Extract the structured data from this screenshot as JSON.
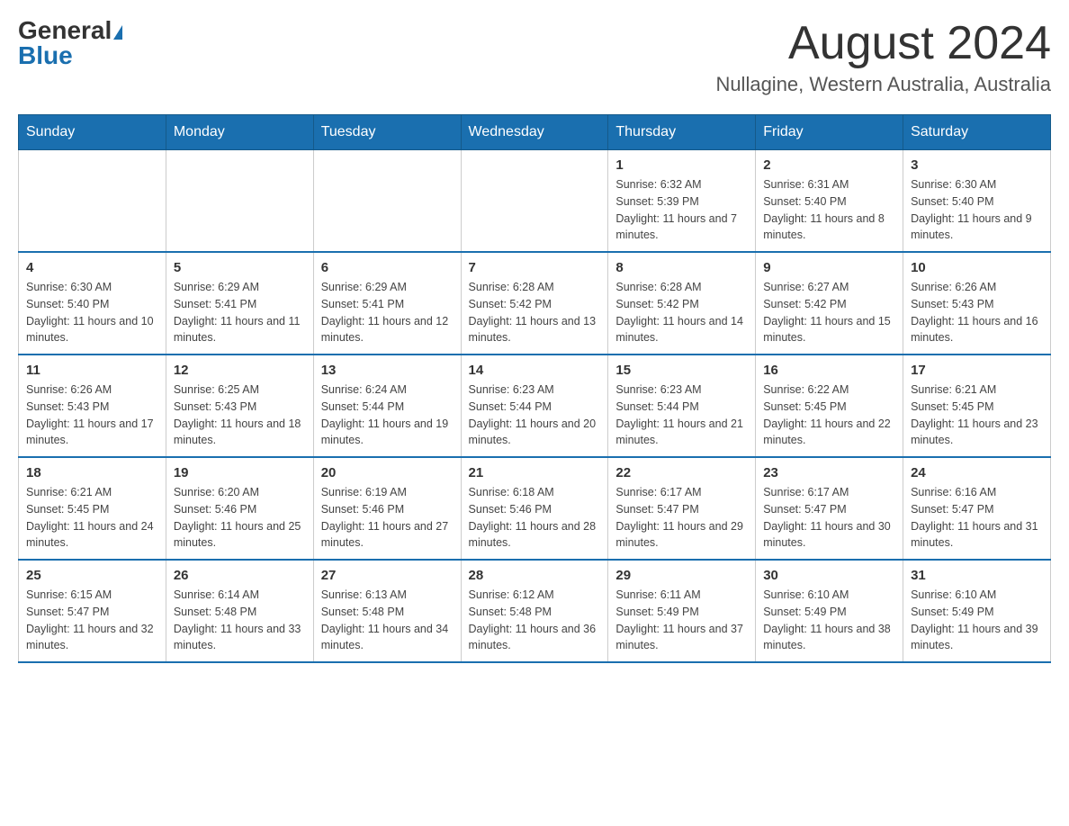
{
  "header": {
    "logo_general": "General",
    "logo_blue": "Blue",
    "month_title": "August 2024",
    "location": "Nullagine, Western Australia, Australia"
  },
  "days_of_week": [
    "Sunday",
    "Monday",
    "Tuesday",
    "Wednesday",
    "Thursday",
    "Friday",
    "Saturday"
  ],
  "weeks": [
    [
      {
        "day": "",
        "info": ""
      },
      {
        "day": "",
        "info": ""
      },
      {
        "day": "",
        "info": ""
      },
      {
        "day": "",
        "info": ""
      },
      {
        "day": "1",
        "info": "Sunrise: 6:32 AM\nSunset: 5:39 PM\nDaylight: 11 hours and 7 minutes."
      },
      {
        "day": "2",
        "info": "Sunrise: 6:31 AM\nSunset: 5:40 PM\nDaylight: 11 hours and 8 minutes."
      },
      {
        "day": "3",
        "info": "Sunrise: 6:30 AM\nSunset: 5:40 PM\nDaylight: 11 hours and 9 minutes."
      }
    ],
    [
      {
        "day": "4",
        "info": "Sunrise: 6:30 AM\nSunset: 5:40 PM\nDaylight: 11 hours and 10 minutes."
      },
      {
        "day": "5",
        "info": "Sunrise: 6:29 AM\nSunset: 5:41 PM\nDaylight: 11 hours and 11 minutes."
      },
      {
        "day": "6",
        "info": "Sunrise: 6:29 AM\nSunset: 5:41 PM\nDaylight: 11 hours and 12 minutes."
      },
      {
        "day": "7",
        "info": "Sunrise: 6:28 AM\nSunset: 5:42 PM\nDaylight: 11 hours and 13 minutes."
      },
      {
        "day": "8",
        "info": "Sunrise: 6:28 AM\nSunset: 5:42 PM\nDaylight: 11 hours and 14 minutes."
      },
      {
        "day": "9",
        "info": "Sunrise: 6:27 AM\nSunset: 5:42 PM\nDaylight: 11 hours and 15 minutes."
      },
      {
        "day": "10",
        "info": "Sunrise: 6:26 AM\nSunset: 5:43 PM\nDaylight: 11 hours and 16 minutes."
      }
    ],
    [
      {
        "day": "11",
        "info": "Sunrise: 6:26 AM\nSunset: 5:43 PM\nDaylight: 11 hours and 17 minutes."
      },
      {
        "day": "12",
        "info": "Sunrise: 6:25 AM\nSunset: 5:43 PM\nDaylight: 11 hours and 18 minutes."
      },
      {
        "day": "13",
        "info": "Sunrise: 6:24 AM\nSunset: 5:44 PM\nDaylight: 11 hours and 19 minutes."
      },
      {
        "day": "14",
        "info": "Sunrise: 6:23 AM\nSunset: 5:44 PM\nDaylight: 11 hours and 20 minutes."
      },
      {
        "day": "15",
        "info": "Sunrise: 6:23 AM\nSunset: 5:44 PM\nDaylight: 11 hours and 21 minutes."
      },
      {
        "day": "16",
        "info": "Sunrise: 6:22 AM\nSunset: 5:45 PM\nDaylight: 11 hours and 22 minutes."
      },
      {
        "day": "17",
        "info": "Sunrise: 6:21 AM\nSunset: 5:45 PM\nDaylight: 11 hours and 23 minutes."
      }
    ],
    [
      {
        "day": "18",
        "info": "Sunrise: 6:21 AM\nSunset: 5:45 PM\nDaylight: 11 hours and 24 minutes."
      },
      {
        "day": "19",
        "info": "Sunrise: 6:20 AM\nSunset: 5:46 PM\nDaylight: 11 hours and 25 minutes."
      },
      {
        "day": "20",
        "info": "Sunrise: 6:19 AM\nSunset: 5:46 PM\nDaylight: 11 hours and 27 minutes."
      },
      {
        "day": "21",
        "info": "Sunrise: 6:18 AM\nSunset: 5:46 PM\nDaylight: 11 hours and 28 minutes."
      },
      {
        "day": "22",
        "info": "Sunrise: 6:17 AM\nSunset: 5:47 PM\nDaylight: 11 hours and 29 minutes."
      },
      {
        "day": "23",
        "info": "Sunrise: 6:17 AM\nSunset: 5:47 PM\nDaylight: 11 hours and 30 minutes."
      },
      {
        "day": "24",
        "info": "Sunrise: 6:16 AM\nSunset: 5:47 PM\nDaylight: 11 hours and 31 minutes."
      }
    ],
    [
      {
        "day": "25",
        "info": "Sunrise: 6:15 AM\nSunset: 5:47 PM\nDaylight: 11 hours and 32 minutes."
      },
      {
        "day": "26",
        "info": "Sunrise: 6:14 AM\nSunset: 5:48 PM\nDaylight: 11 hours and 33 minutes."
      },
      {
        "day": "27",
        "info": "Sunrise: 6:13 AM\nSunset: 5:48 PM\nDaylight: 11 hours and 34 minutes."
      },
      {
        "day": "28",
        "info": "Sunrise: 6:12 AM\nSunset: 5:48 PM\nDaylight: 11 hours and 36 minutes."
      },
      {
        "day": "29",
        "info": "Sunrise: 6:11 AM\nSunset: 5:49 PM\nDaylight: 11 hours and 37 minutes."
      },
      {
        "day": "30",
        "info": "Sunrise: 6:10 AM\nSunset: 5:49 PM\nDaylight: 11 hours and 38 minutes."
      },
      {
        "day": "31",
        "info": "Sunrise: 6:10 AM\nSunset: 5:49 PM\nDaylight: 11 hours and 39 minutes."
      }
    ]
  ]
}
